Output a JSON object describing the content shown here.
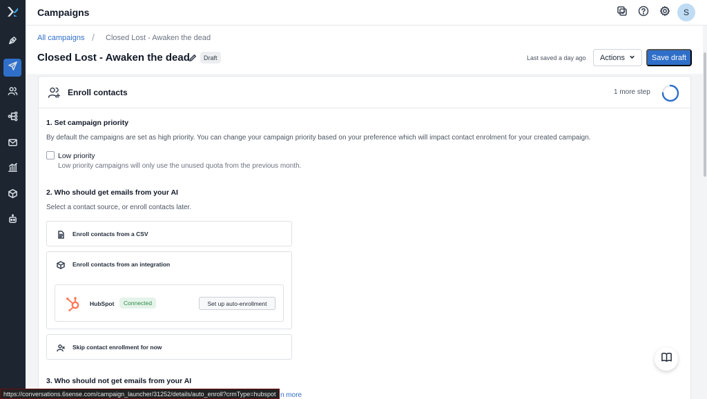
{
  "app": {
    "title": "Campaigns",
    "avatar_initial": "S"
  },
  "breadcrumb": {
    "parent": "All campaigns",
    "separator": "/",
    "current": "Closed Lost - Awaken the dead"
  },
  "page": {
    "title": "Closed Lost - Awaken the dead",
    "status_badge": "Draft",
    "last_saved": "Last saved a day ago",
    "actions_label": "Actions",
    "save_label": "Save draft"
  },
  "card": {
    "title": "Enroll contacts",
    "steps_remaining": "1 more step",
    "progress": 0.75
  },
  "section1": {
    "title": "1. Set campaign priority",
    "text": "By default the campaigns are set as high priority. You can change your campaign priority based on your preference which will impact contact enrolment for your created campaign.",
    "checkbox_label": "Low priority",
    "checkbox_help": "Low priority campaigns will only use the unused quota from the previous month.",
    "checked": false
  },
  "section2": {
    "title": "2. Who should get emails from your AI",
    "text": "Select a contact source, or enroll contacts later.",
    "options": {
      "csv": "Enroll contacts from a CSV",
      "integration": "Enroll contacts from an integration",
      "skip": "Skip contact enrollment for now"
    },
    "hubspot": {
      "name": "HubSpot",
      "status": "Connected",
      "button": "Set up auto-enrollment"
    }
  },
  "section3": {
    "title": "3. Who should not get emails from your AI",
    "link_fragment": "n more"
  },
  "statusbar": {
    "url": "https://conversations.6sense.com/campaign_launcher/31252/details/auto_enroll?crmType=hubspot"
  },
  "colors": {
    "accent": "#2f6fc9",
    "sidebar": "#1c2530",
    "connected": "#2f8a4c",
    "hubspot": "#ff7a59"
  },
  "icons": {
    "sidebar": [
      "pen-nib-icon",
      "paper-plane-icon",
      "users-icon",
      "workflow-icon",
      "mail-icon",
      "chart-icon",
      "package-icon",
      "bot-icon"
    ],
    "topbar": [
      "copy-icon",
      "help-icon",
      "gear-icon"
    ]
  }
}
